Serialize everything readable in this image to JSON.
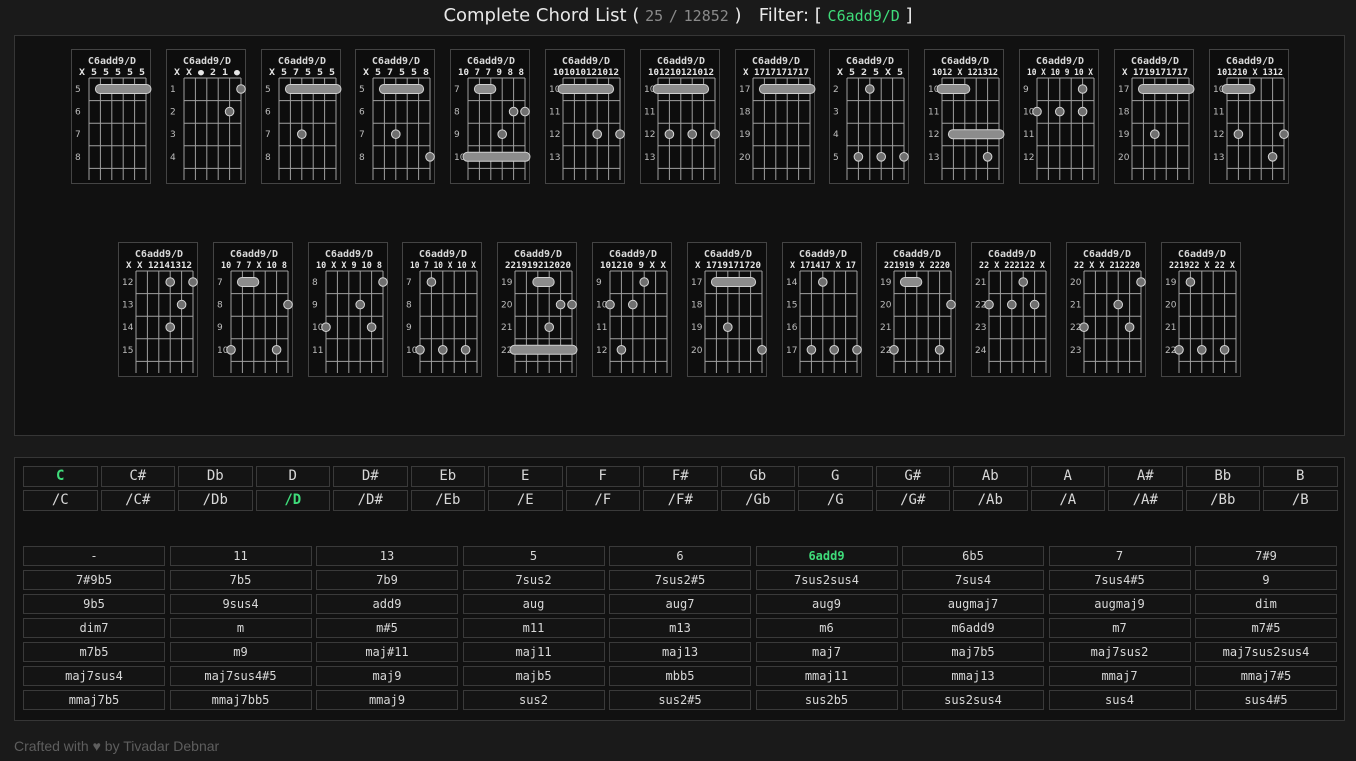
{
  "header": {
    "title": "Complete Chord List (",
    "shown": "25",
    "separator": "/",
    "total": "12852",
    "close_paren": ")",
    "filter_label": "Filter: [",
    "filter_value": "C6add9/D",
    "filter_close": "]"
  },
  "chords": [
    {
      "name": "C6add9/D",
      "frets": "X 5 5 5 5 5",
      "start": 5,
      "dots": [],
      "barres": [
        {
          "fret": 5,
          "from": 1,
          "to": 5
        }
      ]
    },
    {
      "name": "C6add9/D",
      "frets": "X X ● 2 1 ●",
      "start": 1,
      "dots": [
        {
          "string": 4,
          "fret": 2
        },
        {
          "string": 5,
          "fret": 1
        }
      ],
      "barres": []
    },
    {
      "name": "C6add9/D",
      "frets": "X 5 7 5 5 5",
      "start": 5,
      "dots": [
        {
          "string": 2,
          "fret": 7
        }
      ],
      "barres": [
        {
          "fret": 5,
          "from": 1,
          "to": 5
        }
      ]
    },
    {
      "name": "C6add9/D",
      "frets": "X 5 7 5 5 8",
      "start": 5,
      "dots": [
        {
          "string": 2,
          "fret": 7
        },
        {
          "string": 5,
          "fret": 8
        }
      ],
      "barres": [
        {
          "fret": 5,
          "from": 1,
          "to": 4
        }
      ]
    },
    {
      "name": "C6add9/D",
      "frets": "10 7 7 9 8 8",
      "start": 7,
      "dots": [
        {
          "string": 3,
          "fret": 9
        },
        {
          "string": 4,
          "fret": 8
        },
        {
          "string": 5,
          "fret": 8
        }
      ],
      "barres": [
        {
          "fret": 7,
          "from": 1,
          "to": 2
        },
        {
          "fret": 10,
          "from": 0,
          "to": 5
        }
      ]
    },
    {
      "name": "C6add9/D",
      "frets": "101010121012",
      "start": 10,
      "dots": [
        {
          "string": 3,
          "fret": 12
        },
        {
          "string": 5,
          "fret": 12
        }
      ],
      "barres": [
        {
          "fret": 10,
          "from": 0,
          "to": 4
        }
      ]
    },
    {
      "name": "C6add9/D",
      "frets": "101210121012",
      "start": 10,
      "dots": [
        {
          "string": 1,
          "fret": 12
        },
        {
          "string": 3,
          "fret": 12
        },
        {
          "string": 5,
          "fret": 12
        }
      ],
      "barres": [
        {
          "fret": 10,
          "from": 0,
          "to": 4
        }
      ]
    },
    {
      "name": "C6add9/D",
      "frets": "X 1717171717",
      "start": 17,
      "dots": [],
      "barres": [
        {
          "fret": 17,
          "from": 1,
          "to": 5
        }
      ]
    },
    {
      "name": "C6add9/D",
      "frets": "X 5 2 5 X 5",
      "start": 2,
      "dots": [
        {
          "string": 2,
          "fret": 2
        },
        {
          "string": 1,
          "fret": 5
        },
        {
          "string": 3,
          "fret": 5
        },
        {
          "string": 5,
          "fret": 5
        }
      ],
      "barres": []
    },
    {
      "name": "C6add9/D",
      "frets": "1012 X 121312",
      "start": 10,
      "dots": [
        {
          "string": 4,
          "fret": 13
        }
      ],
      "barres": [
        {
          "fret": 10,
          "from": 0,
          "to": 2
        },
        {
          "fret": 12,
          "from": 1,
          "to": 5
        }
      ]
    },
    {
      "name": "C6add9/D",
      "frets": "10 X 10 9 10 X",
      "start": 9,
      "dots": [
        {
          "string": 4,
          "fret": 9
        },
        {
          "string": 0,
          "fret": 10
        },
        {
          "string": 2,
          "fret": 10
        },
        {
          "string": 4,
          "fret": 10
        }
      ],
      "barres": []
    },
    {
      "name": "C6add9/D",
      "frets": "X 1719171717",
      "start": 17,
      "dots": [
        {
          "string": 2,
          "fret": 19
        }
      ],
      "barres": [
        {
          "fret": 17,
          "from": 1,
          "to": 5
        }
      ]
    },
    {
      "name": "C6add9/D",
      "frets": "101210 X 1312",
      "start": 10,
      "dots": [
        {
          "string": 1,
          "fret": 12
        },
        {
          "string": 5,
          "fret": 12
        },
        {
          "string": 4,
          "fret": 13
        }
      ],
      "barres": [
        {
          "fret": 10,
          "from": 0,
          "to": 2
        }
      ]
    },
    {
      "name": "C6add9/D",
      "frets": "X X 12141312",
      "start": 12,
      "dots": [
        {
          "string": 3,
          "fret": 12
        },
        {
          "string": 5,
          "fret": 12
        },
        {
          "string": 4,
          "fret": 13
        },
        {
          "string": 3,
          "fret": 14
        }
      ],
      "barres": []
    },
    {
      "name": "C6add9/D",
      "frets": "10 7 7 X 10 8",
      "start": 7,
      "dots": [
        {
          "string": 5,
          "fret": 8
        },
        {
          "string": 0,
          "fret": 10
        },
        {
          "string": 4,
          "fret": 10
        }
      ],
      "barres": [
        {
          "fret": 7,
          "from": 1,
          "to": 2
        }
      ]
    },
    {
      "name": "C6add9/D",
      "frets": "10 X X 9 10 8",
      "start": 8,
      "dots": [
        {
          "string": 5,
          "fret": 8
        },
        {
          "string": 3,
          "fret": 9
        },
        {
          "string": 0,
          "fret": 10
        },
        {
          "string": 4,
          "fret": 10
        }
      ],
      "barres": []
    },
    {
      "name": "C6add9/D",
      "frets": "10 7 10 X 10 X",
      "start": 7,
      "dots": [
        {
          "string": 1,
          "fret": 7
        },
        {
          "string": 0,
          "fret": 10
        },
        {
          "string": 2,
          "fret": 10
        },
        {
          "string": 4,
          "fret": 10
        }
      ],
      "barres": []
    },
    {
      "name": "C6add9/D",
      "frets": "221919212020",
      "start": 19,
      "dots": [
        {
          "string": 4,
          "fret": 20
        },
        {
          "string": 5,
          "fret": 20
        },
        {
          "string": 3,
          "fret": 21
        }
      ],
      "barres": [
        {
          "fret": 19,
          "from": 2,
          "to": 3
        },
        {
          "fret": 22,
          "from": 0,
          "to": 5
        }
      ]
    },
    {
      "name": "C6add9/D",
      "frets": "101210 9 X X",
      "start": 9,
      "dots": [
        {
          "string": 3,
          "fret": 9
        },
        {
          "string": 0,
          "fret": 10
        },
        {
          "string": 2,
          "fret": 10
        },
        {
          "string": 1,
          "fret": 12
        }
      ],
      "barres": []
    },
    {
      "name": "C6add9/D",
      "frets": "X 1719171720",
      "start": 17,
      "dots": [
        {
          "string": 2,
          "fret": 19
        },
        {
          "string": 5,
          "fret": 20
        }
      ],
      "barres": [
        {
          "fret": 17,
          "from": 1,
          "to": 4
        }
      ]
    },
    {
      "name": "C6add9/D",
      "frets": "X 171417 X 17",
      "start": 14,
      "dots": [
        {
          "string": 2,
          "fret": 14
        },
        {
          "string": 1,
          "fret": 17
        },
        {
          "string": 3,
          "fret": 17
        },
        {
          "string": 5,
          "fret": 17
        }
      ],
      "barres": []
    },
    {
      "name": "C6add9/D",
      "frets": "221919 X 2220",
      "start": 19,
      "dots": [
        {
          "string": 5,
          "fret": 20
        },
        {
          "string": 0,
          "fret": 22
        },
        {
          "string": 4,
          "fret": 22
        }
      ],
      "barres": [
        {
          "fret": 19,
          "from": 1,
          "to": 2
        }
      ]
    },
    {
      "name": "C6add9/D",
      "frets": "22 X 222122 X",
      "start": 21,
      "dots": [
        {
          "string": 3,
          "fret": 21
        },
        {
          "string": 0,
          "fret": 22
        },
        {
          "string": 2,
          "fret": 22
        },
        {
          "string": 4,
          "fret": 22
        }
      ],
      "barres": []
    },
    {
      "name": "C6add9/D",
      "frets": "22 X X 212220",
      "start": 20,
      "dots": [
        {
          "string": 5,
          "fret": 20
        },
        {
          "string": 3,
          "fret": 21
        },
        {
          "string": 0,
          "fret": 22
        },
        {
          "string": 4,
          "fret": 22
        }
      ],
      "barres": []
    },
    {
      "name": "C6add9/D",
      "frets": "221922 X 22 X",
      "start": 19,
      "dots": [
        {
          "string": 1,
          "fret": 19
        },
        {
          "string": 0,
          "fret": 22
        },
        {
          "string": 2,
          "fret": 22
        },
        {
          "string": 4,
          "fret": 22
        }
      ],
      "barres": []
    }
  ],
  "roots": [
    "C",
    "C#",
    "Db",
    "D",
    "D#",
    "Eb",
    "E",
    "F",
    "F#",
    "Gb",
    "G",
    "G#",
    "Ab",
    "A",
    "A#",
    "Bb",
    "B"
  ],
  "bass": [
    "/C",
    "/C#",
    "/Db",
    "/D",
    "/D#",
    "/Eb",
    "/E",
    "/F",
    "/F#",
    "/Gb",
    "/G",
    "/G#",
    "/Ab",
    "/A",
    "/A#",
    "/Bb",
    "/B"
  ],
  "selected_root": "C",
  "selected_bass": "/D",
  "qualities": [
    "-",
    "11",
    "13",
    "5",
    "6",
    "6add9",
    "6b5",
    "7",
    "7#9",
    "7#9b5",
    "7b5",
    "7b9",
    "7sus2",
    "7sus2#5",
    "7sus2sus4",
    "7sus4",
    "7sus4#5",
    "9",
    "9b5",
    "9sus4",
    "add9",
    "aug",
    "aug7",
    "aug9",
    "augmaj7",
    "augmaj9",
    "dim",
    "dim7",
    "m",
    "m#5",
    "m11",
    "m13",
    "m6",
    "m6add9",
    "m7",
    "m7#5",
    "m7b5",
    "m9",
    "maj#11",
    "maj11",
    "maj13",
    "maj7",
    "maj7b5",
    "maj7sus2",
    "maj7sus2sus4",
    "maj7sus4",
    "maj7sus4#5",
    "maj9",
    "majb5",
    "mbb5",
    "mmaj11",
    "mmaj13",
    "mmaj7",
    "mmaj7#5",
    "mmaj7b5",
    "mmaj7bb5",
    "mmaj9",
    "sus2",
    "sus2#5",
    "sus2b5",
    "sus2sus4",
    "sus4",
    "sus4#5"
  ],
  "selected_quality": "6add9",
  "footer": "Crafted with ♥ by Tivadar Debnar",
  "colors": {
    "accent": "#3fdc7a",
    "background": "#1a1a1a",
    "panel": "#111111"
  }
}
